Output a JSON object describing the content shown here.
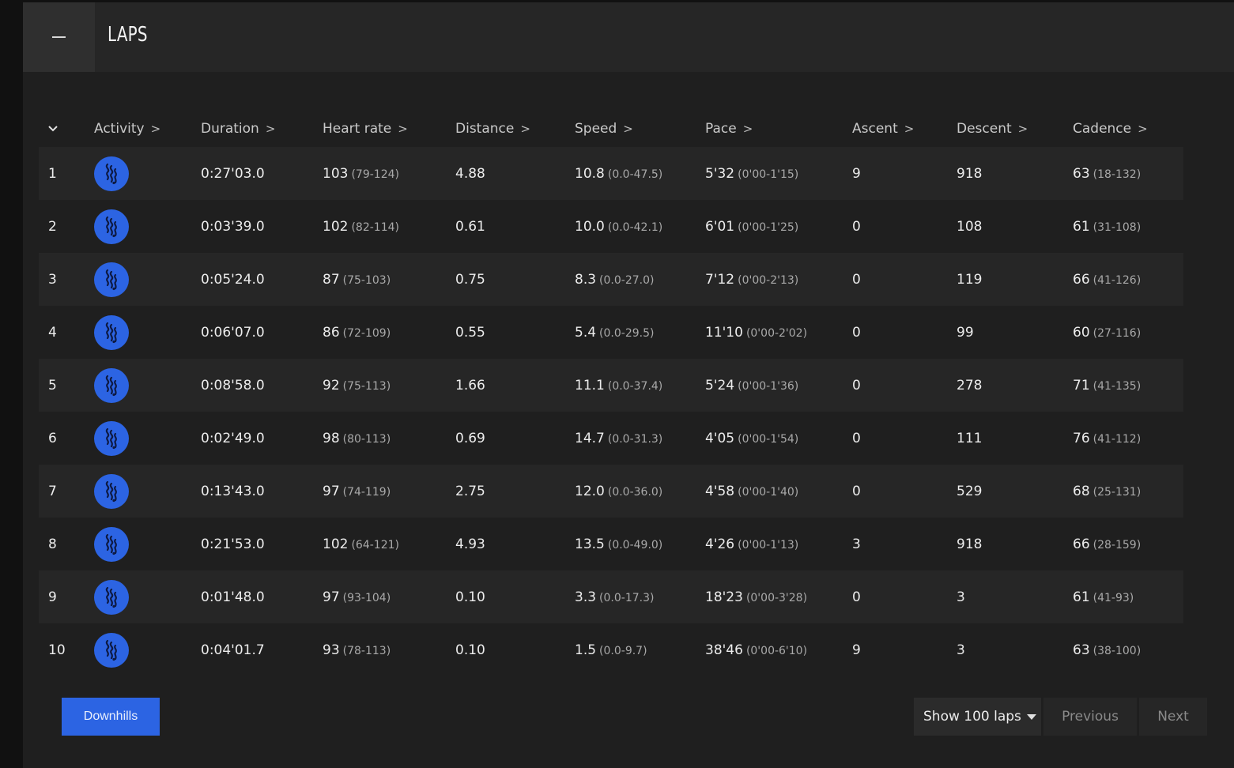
{
  "header": {
    "title": "LAPS"
  },
  "table": {
    "columns": [
      "Activity",
      "Duration",
      "Heart rate",
      "Distance",
      "Speed",
      "Pace",
      "Ascent",
      "Descent",
      "Cadence"
    ],
    "rows": [
      {
        "lap": "1",
        "duration": "0:27'03.0",
        "hr": "103",
        "hr_range": "(79-124)",
        "distance": "4.88",
        "speed": "10.8",
        "speed_range": "(0.0-47.5)",
        "pace": "5'32",
        "pace_range": "(0'00-1'15)",
        "ascent": "9",
        "descent": "918",
        "cadence": "63",
        "cadence_range": "(18-132)"
      },
      {
        "lap": "2",
        "duration": "0:03'39.0",
        "hr": "102",
        "hr_range": "(82-114)",
        "distance": "0.61",
        "speed": "10.0",
        "speed_range": "(0.0-42.1)",
        "pace": "6'01",
        "pace_range": "(0'00-1'25)",
        "ascent": "0",
        "descent": "108",
        "cadence": "61",
        "cadence_range": "(31-108)"
      },
      {
        "lap": "3",
        "duration": "0:05'24.0",
        "hr": "87",
        "hr_range": "(75-103)",
        "distance": "0.75",
        "speed": "8.3",
        "speed_range": "(0.0-27.0)",
        "pace": "7'12",
        "pace_range": "(0'00-2'13)",
        "ascent": "0",
        "descent": "119",
        "cadence": "66",
        "cadence_range": "(41-126)"
      },
      {
        "lap": "4",
        "duration": "0:06'07.0",
        "hr": "86",
        "hr_range": "(72-109)",
        "distance": "0.55",
        "speed": "5.4",
        "speed_range": "(0.0-29.5)",
        "pace": "11'10",
        "pace_range": "(0'00-2'02)",
        "ascent": "0",
        "descent": "99",
        "cadence": "60",
        "cadence_range": "(27-116)"
      },
      {
        "lap": "5",
        "duration": "0:08'58.0",
        "hr": "92",
        "hr_range": "(75-113)",
        "distance": "1.66",
        "speed": "11.1",
        "speed_range": "(0.0-37.4)",
        "pace": "5'24",
        "pace_range": "(0'00-1'36)",
        "ascent": "0",
        "descent": "278",
        "cadence": "71",
        "cadence_range": "(41-135)"
      },
      {
        "lap": "6",
        "duration": "0:02'49.0",
        "hr": "98",
        "hr_range": "(80-113)",
        "distance": "0.69",
        "speed": "14.7",
        "speed_range": "(0.0-31.3)",
        "pace": "4'05",
        "pace_range": "(0'00-1'54)",
        "ascent": "0",
        "descent": "111",
        "cadence": "76",
        "cadence_range": "(41-112)"
      },
      {
        "lap": "7",
        "duration": "0:13'43.0",
        "hr": "97",
        "hr_range": "(74-119)",
        "distance": "2.75",
        "speed": "12.0",
        "speed_range": "(0.0-36.0)",
        "pace": "4'58",
        "pace_range": "(0'00-1'40)",
        "ascent": "0",
        "descent": "529",
        "cadence": "68",
        "cadence_range": "(25-131)"
      },
      {
        "lap": "8",
        "duration": "0:21'53.0",
        "hr": "102",
        "hr_range": "(64-121)",
        "distance": "4.93",
        "speed": "13.5",
        "speed_range": "(0.0-49.0)",
        "pace": "4'26",
        "pace_range": "(0'00-1'13)",
        "ascent": "3",
        "descent": "918",
        "cadence": "66",
        "cadence_range": "(28-159)"
      },
      {
        "lap": "9",
        "duration": "0:01'48.0",
        "hr": "97",
        "hr_range": "(93-104)",
        "distance": "0.10",
        "speed": "3.3",
        "speed_range": "(0.0-17.3)",
        "pace": "18'23",
        "pace_range": "(0'00-3'28)",
        "ascent": "0",
        "descent": "3",
        "cadence": "61",
        "cadence_range": "(41-93)"
      },
      {
        "lap": "10",
        "duration": "0:04'01.7",
        "hr": "93",
        "hr_range": "(78-113)",
        "distance": "0.10",
        "speed": "1.5",
        "speed_range": "(0.0-9.7)",
        "pace": "38'46",
        "pace_range": "(0'00-6'10)",
        "ascent": "9",
        "descent": "3",
        "cadence": "63",
        "cadence_range": "(38-100)"
      }
    ]
  },
  "footer": {
    "downhills_label": "Downhills",
    "show_laps_label": "Show 100 laps",
    "previous_label": "Previous",
    "next_label": "Next"
  },
  "colors": {
    "accent": "#2c64e3",
    "panel": "#1f1f1f",
    "row_alt": "#262626"
  },
  "icons": {
    "activity": "skiing-swirl-icon",
    "collapse": "minus-icon",
    "sort": "chevron-down-icon",
    "column_sort": "chevron-right-icon"
  }
}
